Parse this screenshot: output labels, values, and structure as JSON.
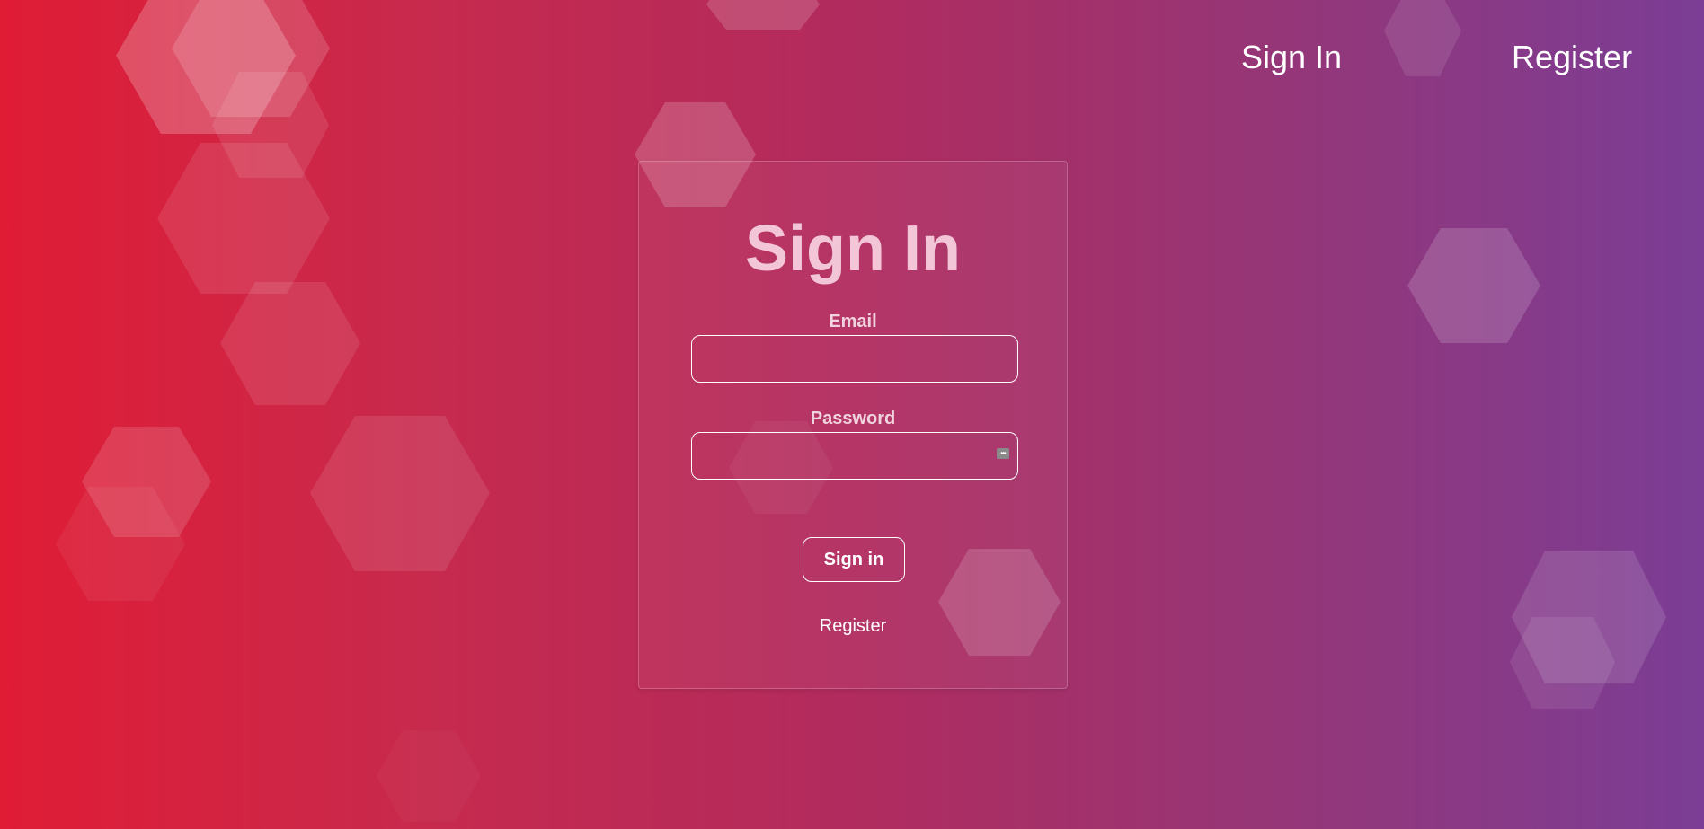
{
  "nav": {
    "signin_label": "Sign In",
    "register_label": "Register"
  },
  "form": {
    "title": "Sign In",
    "email_label": "Email",
    "email_value": "",
    "password_label": "Password",
    "password_value": "",
    "submit_label": "Sign in",
    "register_link_label": "Register"
  },
  "theme": {
    "gradient_start": "#e01c35",
    "gradient_end": "#7b3d95",
    "title_color": "#f2c6d6"
  },
  "icons": {
    "password_manager": "password-manager-icon"
  }
}
